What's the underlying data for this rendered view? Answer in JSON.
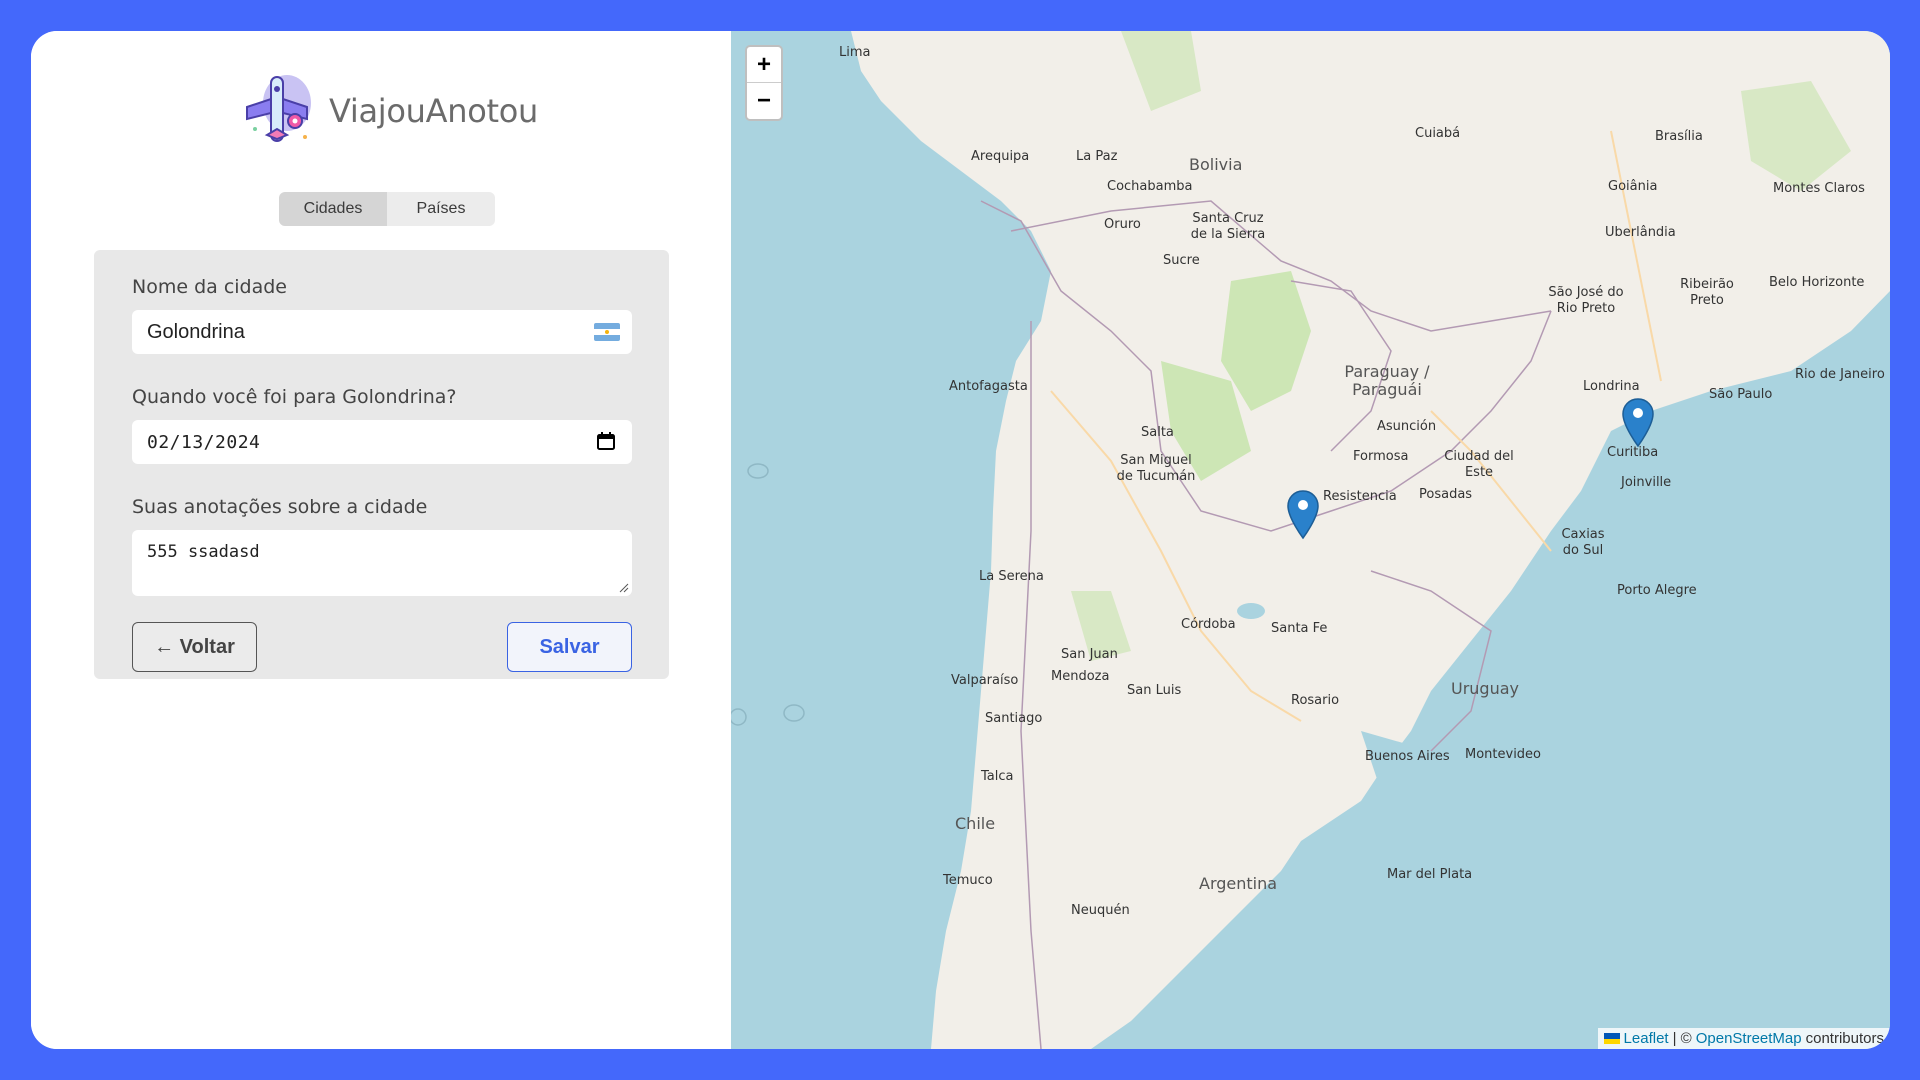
{
  "app": {
    "name": "ViajouAnotou"
  },
  "tabs": [
    {
      "label": "Cidades",
      "active": true
    },
    {
      "label": "Países",
      "active": false
    }
  ],
  "form": {
    "city_label": "Nome da cidade",
    "city_value": "Golondrina",
    "country_flag": "argentina-flag",
    "date_label": "Quando você foi para Golondrina?",
    "date_value": "02/13/2024",
    "notes_label": "Suas anotações sobre a cidade",
    "notes_value": "555 ssadasd",
    "back_label": "← Voltar",
    "save_label": "Salvar"
  },
  "map": {
    "zoom_in": "+",
    "zoom_out": "−",
    "attribution": {
      "leaflet": "Leaflet",
      "separator": "| ©",
      "osm": "OpenStreetMap",
      "suffix": "contributors"
    },
    "labels": {
      "countries": [
        "Bolivia",
        "Paraguay / Paraguái",
        "Argentina",
        "Chile",
        "Uruguay"
      ],
      "cities": [
        "Lima",
        "Arequipa",
        "La Paz",
        "Cochabamba",
        "Oruro",
        "Sucre",
        "Santa Cruz de la Sierra",
        "Cuiabá",
        "Brasília",
        "Goiânia",
        "Montes Claros",
        "Uberlândia",
        "Belo Horizonte",
        "São José do Rio Preto",
        "Ribeirão Preto",
        "Antofagasta",
        "Salta",
        "San Miguel de Tucumán",
        "Asunción",
        "Formosa",
        "Resistencia",
        "Ciudad del Este",
        "Posadas",
        "São Paulo",
        "Rio de Janeiro",
        "Londrina",
        "Curitiba",
        "Joinville",
        "Caxias do Sul",
        "Porto Alegre",
        "La Serena",
        "Córdoba",
        "Santa Fe",
        "Rosario",
        "San Juan",
        "Mendoza",
        "San Luis",
        "Valparaíso",
        "Santiago",
        "Buenos Aires",
        "Montevideo",
        "Talca",
        "Mar del Plata",
        "Temuco",
        "Neuquén"
      ]
    }
  },
  "colors": {
    "background": "#4468fb",
    "accent": "#3a63e3",
    "marker": "#2a81cb"
  }
}
